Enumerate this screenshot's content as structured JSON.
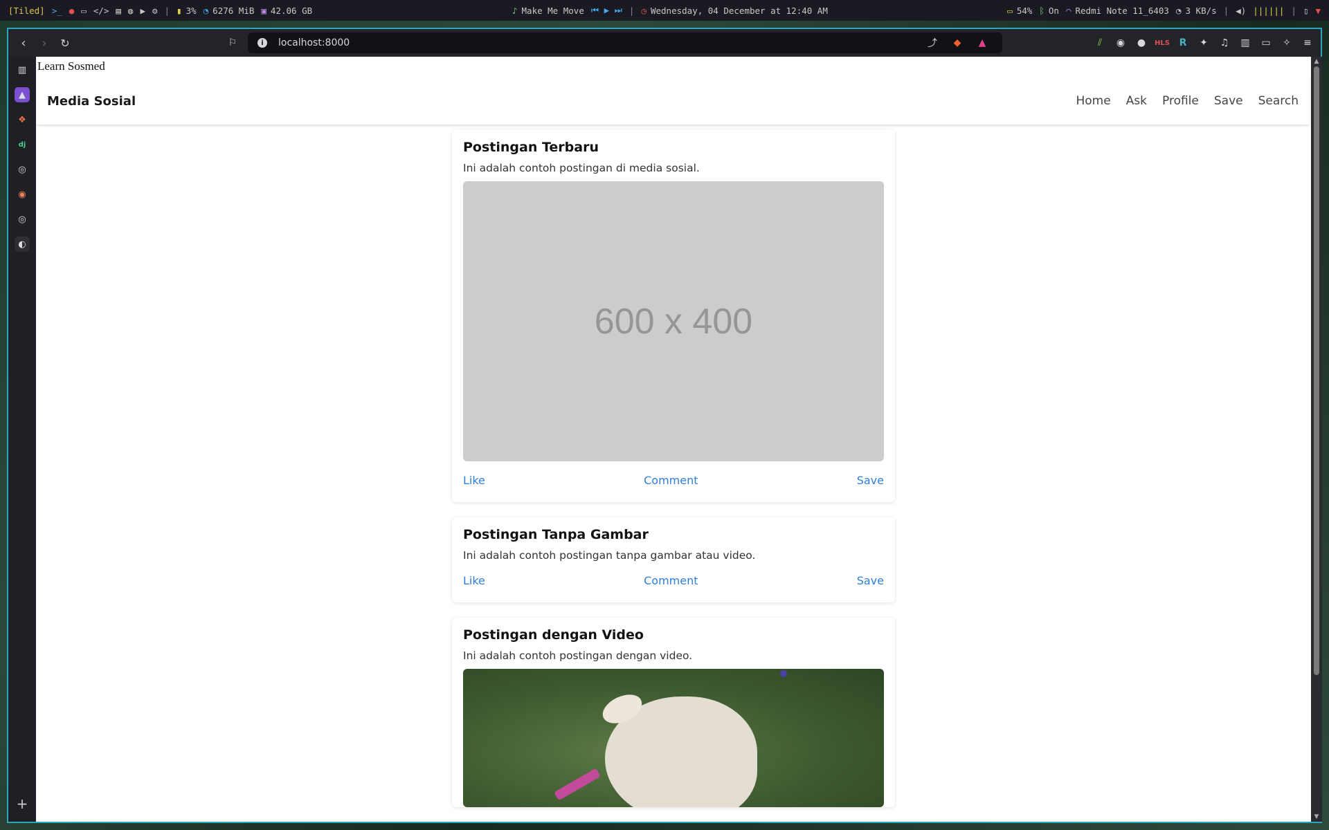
{
  "system_bar": {
    "workspace_mode": "[Tiled]",
    "cpu": "3%",
    "memory": "6276 MiB",
    "disk": "42.06 GB",
    "now_playing": "Make Me Move",
    "datetime": "Wednesday, 04 December at 12:40 AM",
    "battery": "54%",
    "bluetooth": "On",
    "wifi": "Redmi Note 11_6403",
    "network_speed": "3 KB/s",
    "icons": [
      "terminal-icon",
      "firefox-icon",
      "folder-icon",
      "code-icon",
      "book-icon",
      "chat-icon",
      "youtube-icon",
      "settings-icon",
      "chart-icon",
      "pie-icon",
      "disk-icon",
      "music-icon",
      "clock-icon",
      "battery-icon",
      "bluetooth-icon",
      "wifi-icon",
      "speed-icon",
      "volume-icon"
    ]
  },
  "browser": {
    "url": "localhost:8000",
    "accent": "#2aa6c0",
    "extensions": [
      "stats-icon",
      "dash-icon",
      "record-icon",
      "hls-icon",
      "r-icon",
      "puzzle-icon",
      "music-note-icon",
      "sidebar-toggle-icon",
      "wallet-icon",
      "leo-icon",
      "menu-icon"
    ],
    "hls_label": "HLS",
    "r_label": "R",
    "side_icons": [
      "sidebar-panel-icon",
      "rocket-icon",
      "figma-icon",
      "django-icon",
      "github-icon",
      "brave-news-icon",
      "github-icon",
      "globe-icon"
    ],
    "django_label": "dj"
  },
  "page": {
    "doc_title": "Learn Sosmed",
    "brand": "Media Sosial",
    "nav": [
      "Home",
      "Ask",
      "Profile",
      "Save",
      "Search"
    ],
    "link_color": "#2f7fd7",
    "posts": [
      {
        "title": "Postingan Terbaru",
        "body": "Ini adalah contoh postingan di media sosial.",
        "media": "image",
        "image_text": "600 x 400",
        "actions": [
          "Like",
          "Comment",
          "Save"
        ]
      },
      {
        "title": "Postingan Tanpa Gambar",
        "body": "Ini adalah contoh postingan tanpa gambar atau video.",
        "media": "none",
        "actions": [
          "Like",
          "Comment",
          "Save"
        ]
      },
      {
        "title": "Postingan dengan Video",
        "body": "Ini adalah contoh postingan dengan video.",
        "media": "video"
      }
    ]
  }
}
